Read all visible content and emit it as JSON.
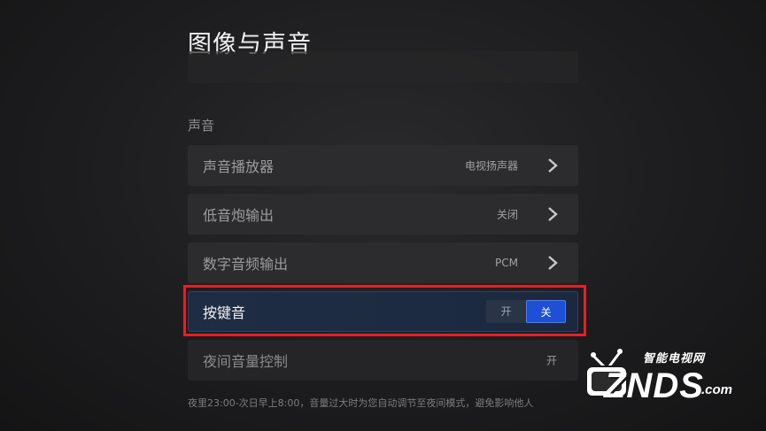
{
  "page": {
    "title": "图像与声音"
  },
  "section": {
    "header": "声音"
  },
  "rows": [
    {
      "label": "声音播放器",
      "value": "电视扬声器",
      "icon": "chevron-right-icon"
    },
    {
      "label": "低音炮输出",
      "value": "关闭",
      "icon": "chevron-right-icon"
    },
    {
      "label": "数字音频输出",
      "value": "PCM",
      "icon": "chevron-right-icon"
    }
  ],
  "key_sound": {
    "label": "按键音",
    "on_label": "开",
    "off_label": "关",
    "selected": "关"
  },
  "night_volume": {
    "label": "夜间音量控制",
    "value": "开"
  },
  "footnote": "夜里23:00-次日早上8:00，音量过大时为您自动调节至夜间模式，避免影响他人",
  "watermark": {
    "small_text": "智能电视网",
    "brand": "ZNDS",
    "suffix": ".com"
  },
  "colors": {
    "highlight_border": "#e12228",
    "toggle_active": "#1e4fd6",
    "focused_row": "#1f2d44"
  }
}
